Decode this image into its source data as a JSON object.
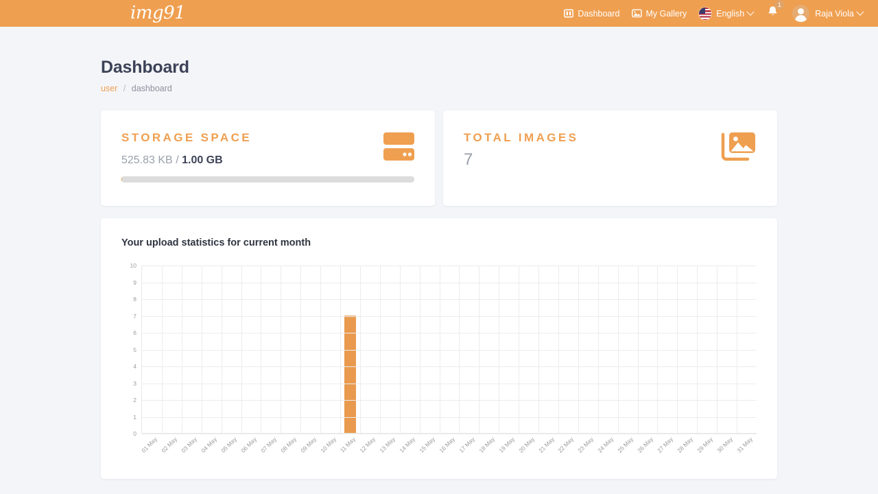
{
  "navbar": {
    "brand": "img91",
    "items": [
      {
        "label": "Dashboard",
        "icon": "columns-icon"
      },
      {
        "label": "My Gallery",
        "icon": "image-icon"
      }
    ],
    "language": {
      "label": "English",
      "flag": "us-flag-icon"
    },
    "notifications": {
      "count": "1",
      "icon": "bell-icon"
    },
    "user": {
      "name": "Raja Viola",
      "avatar": "avatar-icon"
    },
    "bg_color": "#ef9f50"
  },
  "page": {
    "title": "Dashboard",
    "breadcrumb": {
      "root": "user",
      "separator": "/",
      "current": "dashboard"
    }
  },
  "cards": {
    "storage": {
      "title": "STORAGE SPACE",
      "used": "525.83 KB",
      "separator": "/",
      "total": "1.00 GB",
      "progress_percent": 0.05,
      "icon": "server-icon"
    },
    "images": {
      "title": "TOTAL IMAGES",
      "count": "7",
      "icon": "images-icon"
    }
  },
  "chart_data": {
    "type": "bar",
    "title": "Your upload statistics for current month",
    "xlabel": "",
    "ylabel": "",
    "ylim": [
      0,
      10
    ],
    "yticks": [
      0,
      1,
      2,
      3,
      4,
      5,
      6,
      7,
      8,
      9,
      10
    ],
    "grid": true,
    "legend": "none",
    "bar_color": "#e99a4e",
    "categories": [
      "01 May",
      "02 May",
      "03 May",
      "04 May",
      "05 May",
      "06 May",
      "07 May",
      "08 May",
      "09 May",
      "10 May",
      "11 May",
      "12 May",
      "13 May",
      "14 May",
      "15 May",
      "16 May",
      "17 May",
      "18 May",
      "19 May",
      "20 May",
      "21 May",
      "22 May",
      "23 May",
      "24 May",
      "25 May",
      "26 May",
      "27 May",
      "28 May",
      "29 May",
      "30 May",
      "31 May"
    ],
    "values": [
      0,
      0,
      0,
      0,
      0,
      0,
      0,
      0,
      0,
      0,
      7,
      0,
      0,
      0,
      0,
      0,
      0,
      0,
      0,
      0,
      0,
      0,
      0,
      0,
      0,
      0,
      0,
      0,
      0,
      0,
      0
    ]
  }
}
